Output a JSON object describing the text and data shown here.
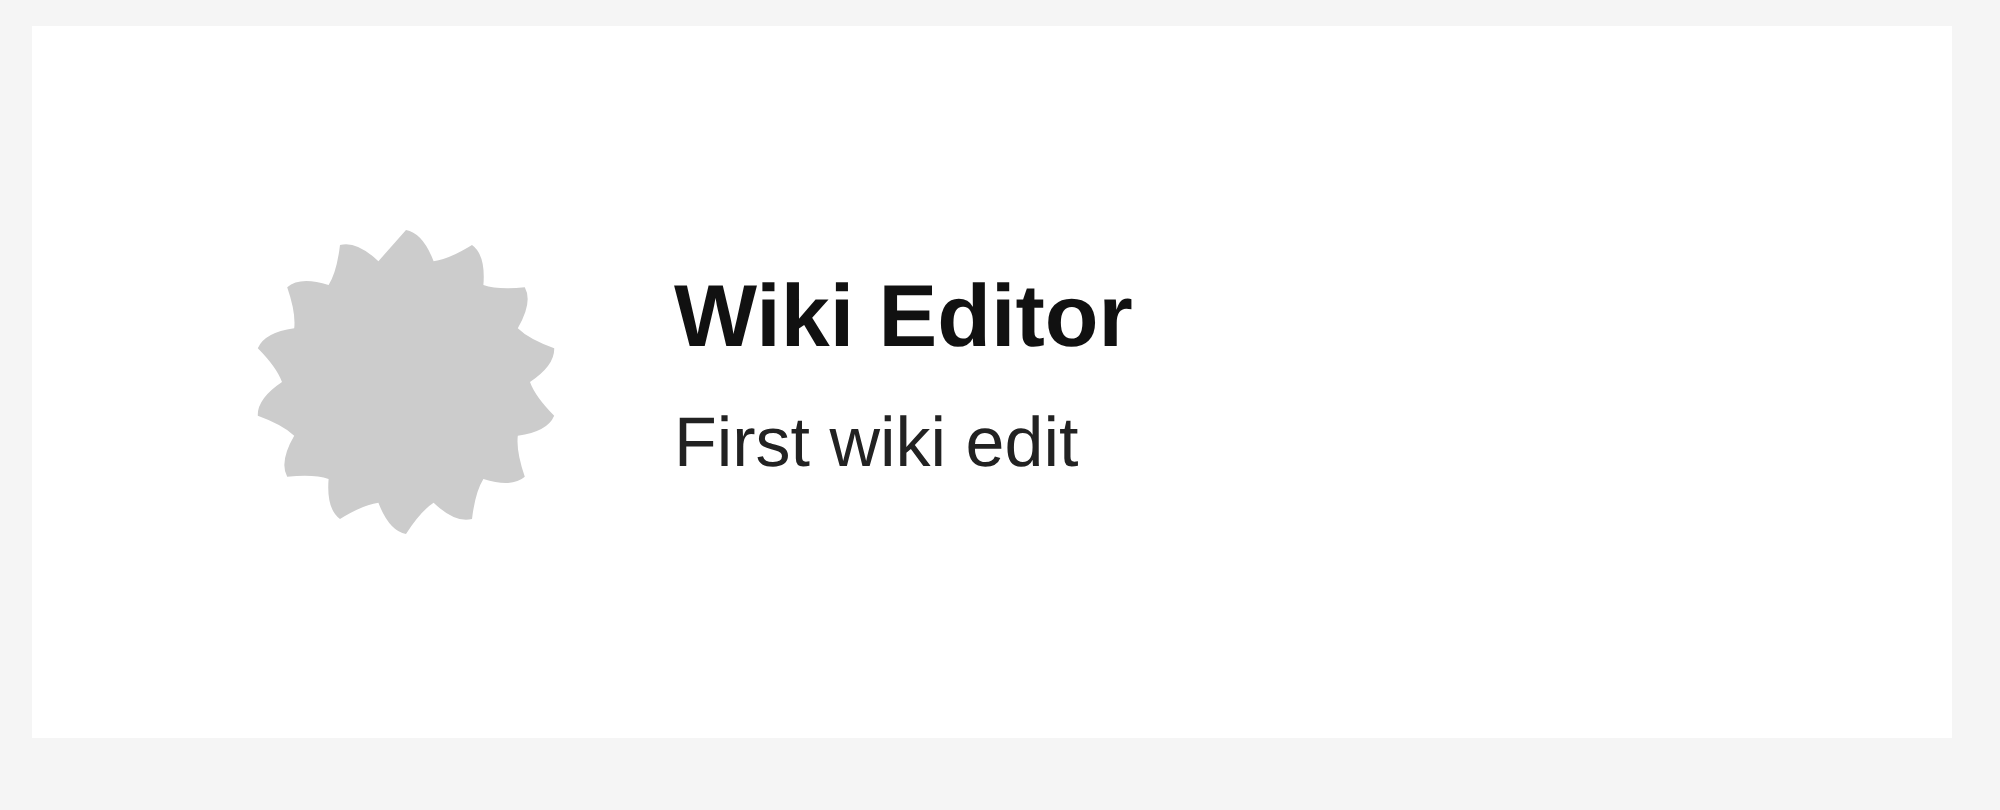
{
  "badge": {
    "title": "Wiki Editor",
    "description": "First wiki edit"
  }
}
